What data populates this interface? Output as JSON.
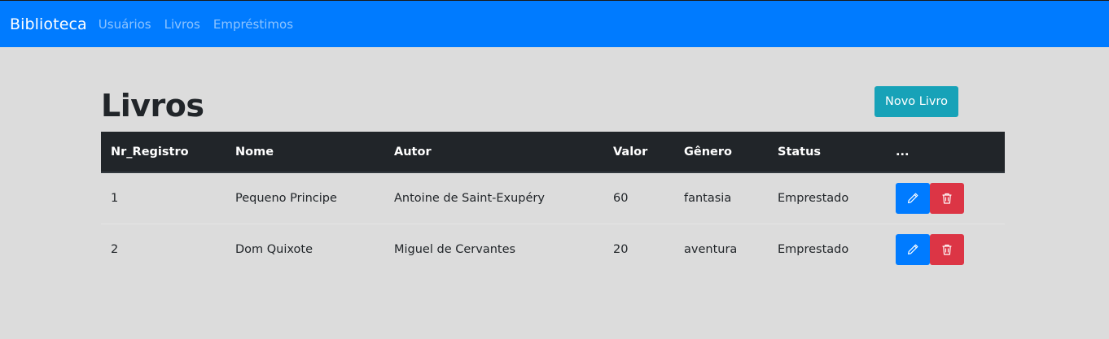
{
  "navbar": {
    "brand": "Biblioteca",
    "links": [
      "Usuários",
      "Livros",
      "Empréstimos"
    ]
  },
  "page": {
    "title": "Livros",
    "new_button_label": "Novo Livro"
  },
  "table": {
    "headers": [
      "Nr_Registro",
      "Nome",
      "Autor",
      "Valor",
      "Gênero",
      "Status",
      "..."
    ],
    "rows": [
      {
        "nr": "1",
        "nome": "Pequeno Principe",
        "autor": "Antoine de Saint-Exupéry",
        "valor": "60",
        "genero": "fantasia",
        "status": "Emprestado"
      },
      {
        "nr": "2",
        "nome": "Dom Quixote",
        "autor": "Miguel de Cervantes",
        "valor": "20",
        "genero": "aventura",
        "status": "Emprestado"
      }
    ],
    "actions": {
      "edit_icon": "pencil-icon",
      "delete_icon": "trash-icon"
    }
  },
  "colors": {
    "navbar": "#007bff",
    "header": "#212529",
    "info_button": "#17a2b8",
    "edit_button": "#007bff",
    "delete_button": "#dc3545"
  }
}
